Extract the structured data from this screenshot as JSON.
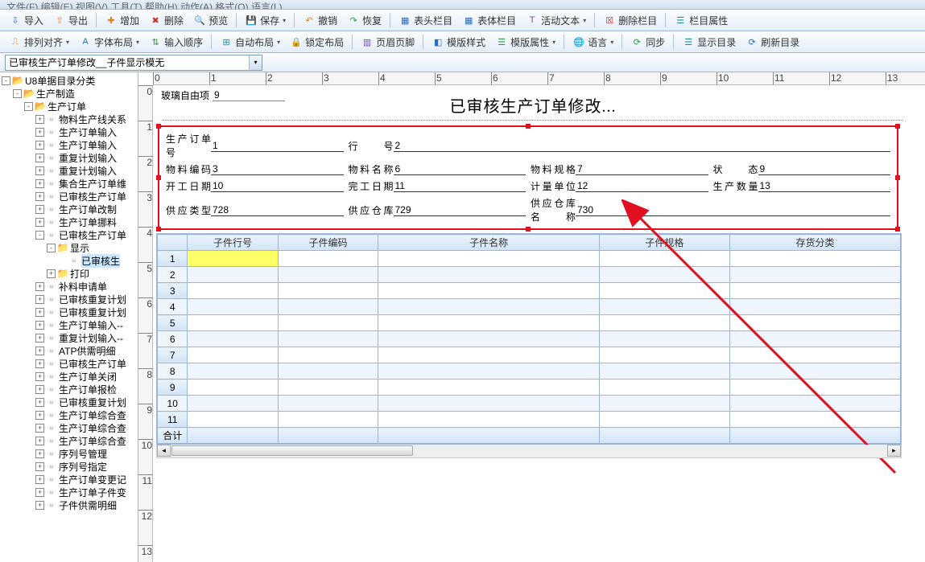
{
  "menu_stub": "文件(F)  编辑(E)  视图(V)  工具(T)  帮助(H)  动作(A)  格式(O)  语言(L)",
  "toolbar1": {
    "import": "导入",
    "export": "导出",
    "add": "增加",
    "delete": "删除",
    "preview": "预览",
    "save": "保存",
    "undo": "撤销",
    "redo": "恢复",
    "headerCols": "表头栏目",
    "bodyCols": "表体栏目",
    "activeText": "活动文本",
    "delCol": "删除栏目",
    "colProps": "栏目属性"
  },
  "toolbar2": {
    "alignArrange": "排列对齐",
    "fontLayout": "字体布局",
    "inputOrder": "输入顺序",
    "autoLayout": "自动布局",
    "lockLayout": "锁定布局",
    "pageHeaderFooter": "页眉页脚",
    "templateStyle": "模版样式",
    "templateProps": "模版属性",
    "language": "语言",
    "sync": "同步",
    "showCatalog": "显示目录",
    "refreshCatalog": "刷新目录"
  },
  "combo": {
    "value": "已审核生产订单修改__子件显示模无"
  },
  "tree": {
    "root": "U8单据目录分类",
    "n1": "生产制造",
    "n2": "生产订单",
    "items": [
      "物料生产线关系",
      "生产订单输入",
      "生产订单输入",
      "重复计划输入",
      "重复计划输入",
      "集合生产订单维",
      "已审核生产订单",
      "生产订单改制",
      "生产订单挪料",
      "已审核生产订单"
    ],
    "sub_display": "显示",
    "sub_display_child": "已审核生",
    "sub_print": "打印",
    "items2": [
      "补料申请单",
      "已审核重复计划",
      "已审核重复计划",
      "生产订单输入--",
      "重复计划输入--",
      "ATP供需明细",
      "已审核生产订单",
      "生产订单关闭",
      "生产订单报检",
      "已审核重复计划",
      "生产订单综合查",
      "生产订单综合查",
      "生产订单综合查",
      "序列号管理",
      "序列号指定",
      "生产订单变更记",
      "生产订单子件变",
      "子件供需明细"
    ]
  },
  "design": {
    "freefield_label": "玻璃自由项",
    "freefield_value": "9",
    "title": "已审核生产订单修改...",
    "fields": {
      "r1": [
        {
          "l": "生产订单号",
          "v": "1"
        },
        {
          "l": "行号",
          "v": "2"
        }
      ],
      "r2": [
        {
          "l": "物料编码",
          "v": "3"
        },
        {
          "l": "物料名称",
          "v": "6"
        },
        {
          "l": "物料规格",
          "v": "7"
        },
        {
          "l": "状态",
          "v": "9"
        }
      ],
      "r3": [
        {
          "l": "开工日期",
          "v": "10"
        },
        {
          "l": "完工日期",
          "v": "11"
        },
        {
          "l": "计量单位",
          "v": "12"
        },
        {
          "l": "生产数量",
          "v": "13"
        }
      ],
      "r4": [
        {
          "l": "供应类型",
          "v": "728"
        },
        {
          "l": "供应仓库",
          "v": "729"
        },
        {
          "l": "供应仓库名称",
          "v": "730"
        }
      ]
    },
    "table": {
      "headers": [
        "子件行号",
        "子件编码",
        "子件名称",
        "子件规格",
        "存货分类"
      ],
      "rows": [
        "1",
        "2",
        "3",
        "4",
        "5",
        "6",
        "7",
        "8",
        "9",
        "10",
        "11"
      ],
      "total_label": "合计"
    }
  }
}
